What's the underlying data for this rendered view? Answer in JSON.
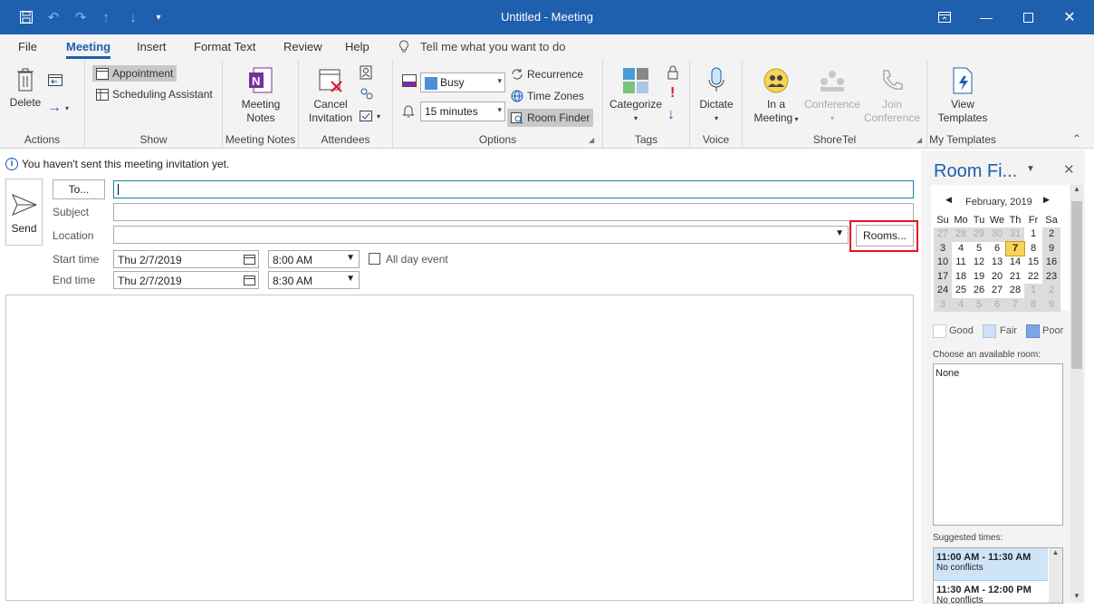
{
  "window": {
    "title": "Untitled  -  Meeting"
  },
  "tabs": [
    "File",
    "Meeting",
    "Insert",
    "Format Text",
    "Review",
    "Help"
  ],
  "tell_me": "Tell me what you want to do",
  "ribbon": {
    "actions": {
      "delete": "Delete",
      "label": "Actions"
    },
    "show": {
      "appointment": "Appointment",
      "scheduling": "Scheduling Assistant",
      "label": "Show"
    },
    "meeting_notes": {
      "btn1": "Meeting",
      "btn2": "Notes",
      "label": "Meeting Notes"
    },
    "attendees": {
      "cancel1": "Cancel",
      "cancel2": "Invitation",
      "label": "Attendees"
    },
    "options": {
      "show_as": "Busy",
      "reminder": "15 minutes",
      "recurrence": "Recurrence",
      "time_zones": "Time Zones",
      "room_finder": "Room Finder",
      "label": "Options"
    },
    "tags": {
      "categorize": "Categorize",
      "label": "Tags"
    },
    "voice": {
      "dictate": "Dictate",
      "label": "Voice"
    },
    "shoretel": {
      "in_meeting1": "In a",
      "in_meeting2": "Meeting",
      "conf1": "Conference",
      "join1": "Join",
      "join2": "Conference",
      "label": "ShoreTel"
    },
    "templates": {
      "view1": "View",
      "view2": "Templates",
      "label": "My Templates"
    }
  },
  "form": {
    "info": "You haven't sent this meeting invitation yet.",
    "send": "Send",
    "to": "To...",
    "subject": "Subject",
    "location": "Location",
    "rooms": "Rooms...",
    "start_label": "Start time",
    "end_label": "End time",
    "start_date": "Thu 2/7/2019",
    "start_time": "8:00 AM",
    "end_date": "Thu 2/7/2019",
    "end_time": "8:30 AM",
    "all_day": "All day event"
  },
  "room_finder": {
    "title": "Room Fi...",
    "month": "February, 2019",
    "weekdays": [
      "Su",
      "Mo",
      "Tu",
      "We",
      "Th",
      "Fr",
      "Sa"
    ],
    "weeks": [
      [
        "27",
        "28",
        "29",
        "30",
        "31",
        "1",
        "2"
      ],
      [
        "3",
        "4",
        "5",
        "6",
        "7",
        "8",
        "9"
      ],
      [
        "10",
        "11",
        "12",
        "13",
        "14",
        "15",
        "16"
      ],
      [
        "17",
        "18",
        "19",
        "20",
        "21",
        "22",
        "23"
      ],
      [
        "24",
        "25",
        "26",
        "27",
        "28",
        "1",
        "2"
      ],
      [
        "3",
        "4",
        "5",
        "6",
        "7",
        "8",
        "9"
      ]
    ],
    "legend": {
      "good": "Good",
      "fair": "Fair",
      "poor": "Poor"
    },
    "choose_label": "Choose an available room:",
    "rooms": [
      "None"
    ],
    "suggested_label": "Suggested times:",
    "suggestions": [
      {
        "time": "11:00 AM - 11:30 AM",
        "status": "No conflicts"
      },
      {
        "time": "11:30 AM - 12:00 PM",
        "status": "No conflicts"
      }
    ]
  },
  "colors": {
    "accent": "#1e5fae",
    "highlight": "#e81123",
    "selected_day": "#f7d358"
  }
}
